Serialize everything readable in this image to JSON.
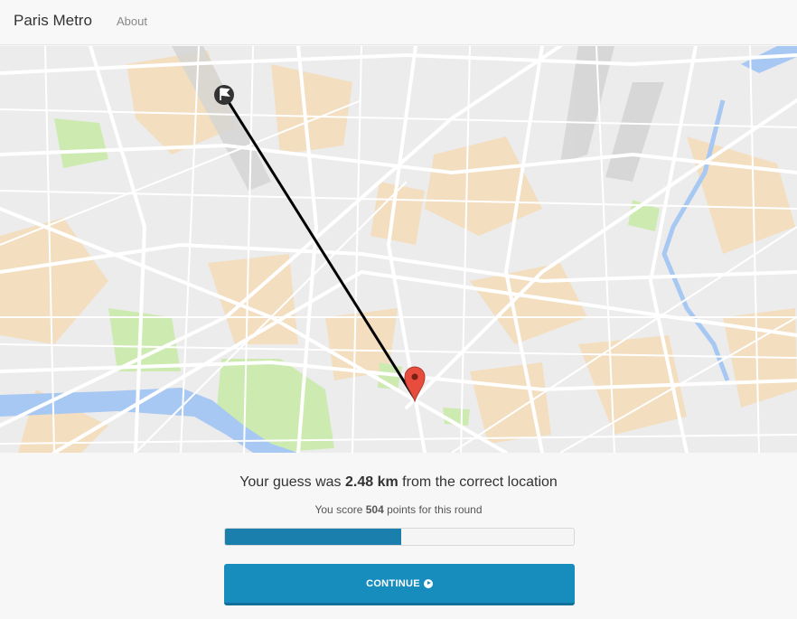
{
  "navbar": {
    "brand": "Paris Metro",
    "links": [
      {
        "label": "About"
      }
    ]
  },
  "result": {
    "prefix": "Your guess was ",
    "distance": "2.48 km",
    "suffix": " from the correct location"
  },
  "score": {
    "prefix": "You score ",
    "points": "504",
    "suffix": " points for this round",
    "progress_fraction": 0.504
  },
  "continue_button": {
    "label": "CONTINUE"
  },
  "colors": {
    "accent": "#178dbd",
    "progress": "#1a7fad",
    "river": "#a7c8f3",
    "park": "#cdebb0",
    "block": "#f5dcb8",
    "marker": "#e74c3c"
  },
  "icons": {
    "flag": "flag-icon",
    "marker": "map-pin-icon",
    "continue": "play-circle-icon"
  }
}
